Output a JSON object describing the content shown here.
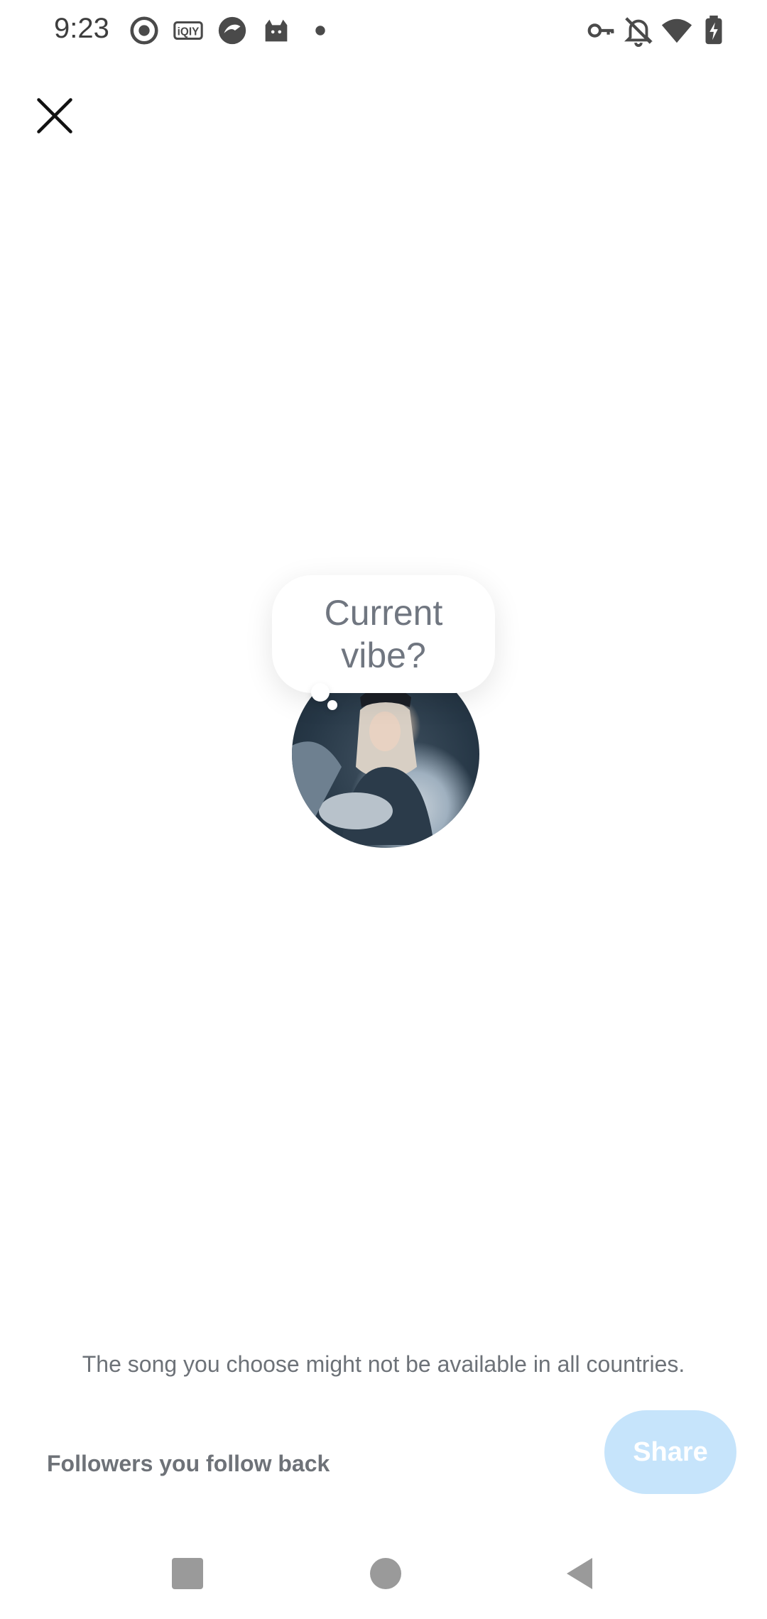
{
  "status_bar": {
    "time": "9:23",
    "left_icons": [
      "record-icon",
      "iqiyi-icon",
      "browser-icon",
      "cat-icon",
      "dot-icon"
    ],
    "right_icons": [
      "key-icon",
      "bell-off-icon",
      "wifi-icon",
      "battery-charging-icon"
    ]
  },
  "dialog": {
    "close_icon": "close-icon",
    "bubble_text": "Current vibe?"
  },
  "footer": {
    "disclaimer": "The song you choose might not be available in all countries.",
    "audience_label": "Followers you follow back",
    "share_label": "Share"
  },
  "colors": {
    "share_button": "#c6e4fb",
    "text_muted": "#6d7278"
  },
  "nav_bar": {
    "icons": [
      "recent-apps-icon",
      "home-icon",
      "back-icon"
    ]
  }
}
